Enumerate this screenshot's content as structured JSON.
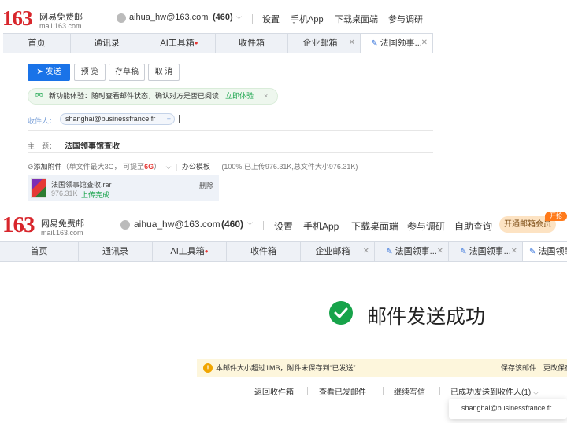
{
  "top": {
    "logo_num": "163",
    "logo_cn": "网易免费邮",
    "logo_sub": "mail.163.com",
    "account": "aihua_hw@163.com",
    "count": "(460)",
    "nav": [
      "设置",
      "手机App",
      "下载桌面端",
      "参与调研"
    ]
  },
  "tabs": [
    "首页",
    "通讯录",
    "AI工具箱",
    "收件箱",
    "企业邮箱",
    "法国领事..."
  ],
  "compose": {
    "buttons": {
      "send": "发送",
      "preview": "预 览",
      "draft": "存草稿",
      "cancel": "取 消"
    },
    "feature": {
      "text": "新功能体验：随时查看邮件状态，确认对方是否已阅读",
      "link": "立即体验",
      "close": "×"
    },
    "to_label": "收件人：",
    "to_chip": "shanghai@businessfrance.fr",
    "to_add": "+",
    "subject_label": "主　题：",
    "subject": "法国领事馆查收",
    "attach": {
      "add_label": "添加附件",
      "limit": "（单文件最大3G，  可提至",
      "limit_highlight": "6G",
      "limit_end": "）",
      "office": "办公模板",
      "progress": "(100%,已上传976.31K,总文件大小976.31K)",
      "filename": "法国领事馆查收.rar",
      "size": "976.31K",
      "status": "上传完成",
      "delete": "删除"
    }
  },
  "bottom": {
    "account": "aihua_hw@163.com",
    "count": "(460)",
    "nav": [
      "设置",
      "手机App",
      "下载桌面端",
      "参与调研",
      "自助查询"
    ],
    "vip": "开通邮箱会员",
    "hot": "开抢",
    "tabs": [
      "首页",
      "通讯录",
      "AI工具箱",
      "收件箱",
      "企业邮箱",
      "法国领事...",
      "法国领事...",
      "法国领事"
    ],
    "success": "邮件发送成功",
    "notice": "本邮件大小超过1MB，附件未保存到“已发送”",
    "notice_actions": [
      "保存该邮件",
      "更改保存"
    ],
    "actions": [
      "返回收件箱",
      "查看已发邮件",
      "继续写信",
      "已成功发送到收件人(1)"
    ],
    "recipient": "shanghai@businessfrance.fr"
  },
  "colors": {
    "brand_red": "#d8262c",
    "primary_blue": "#1a73e8",
    "success_green": "#17a34a",
    "link_green": "#17a34a"
  }
}
